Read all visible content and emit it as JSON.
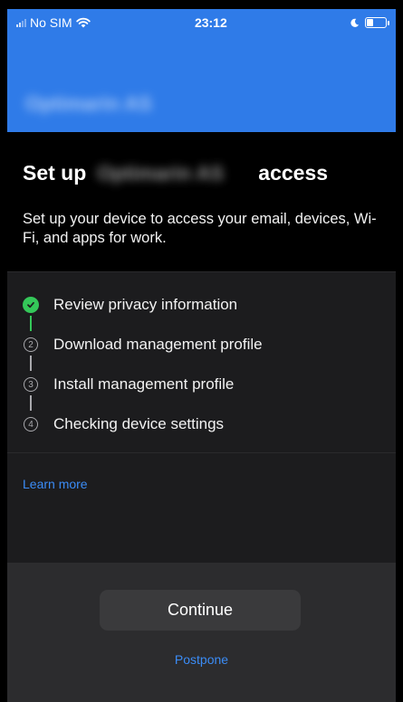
{
  "status_bar": {
    "carrier": "No SIM",
    "time": "23:12",
    "wifi_icon": "wifi-icon",
    "moon_icon": "moon-icon",
    "battery_icon": "battery-icon",
    "battery_level": 0.35
  },
  "header": {
    "org_name": "Optimarin AS",
    "org_name_redacted": true
  },
  "hero": {
    "title_prefix": "Set up",
    "title_org_redacted": "Optimarin AS",
    "title_suffix": "access",
    "subtitle": "Set up your device to access your email, devices, Wi-Fi, and apps for work."
  },
  "steps": [
    {
      "label": "Review privacy information",
      "status": "completed",
      "icon": "check-circle-icon"
    },
    {
      "label": "Download management profile",
      "status": "pending",
      "number": "2"
    },
    {
      "label": "Install management profile",
      "status": "pending",
      "number": "3"
    },
    {
      "label": "Checking device settings",
      "status": "pending",
      "number": "4"
    }
  ],
  "links": {
    "learn_more": "Learn more",
    "postpone": "Postpone"
  },
  "footer": {
    "continue_label": "Continue"
  },
  "colors": {
    "accent": "#2f7be8",
    "link": "#3b8cf6",
    "success": "#34c759",
    "background": "#1c1c1e"
  }
}
